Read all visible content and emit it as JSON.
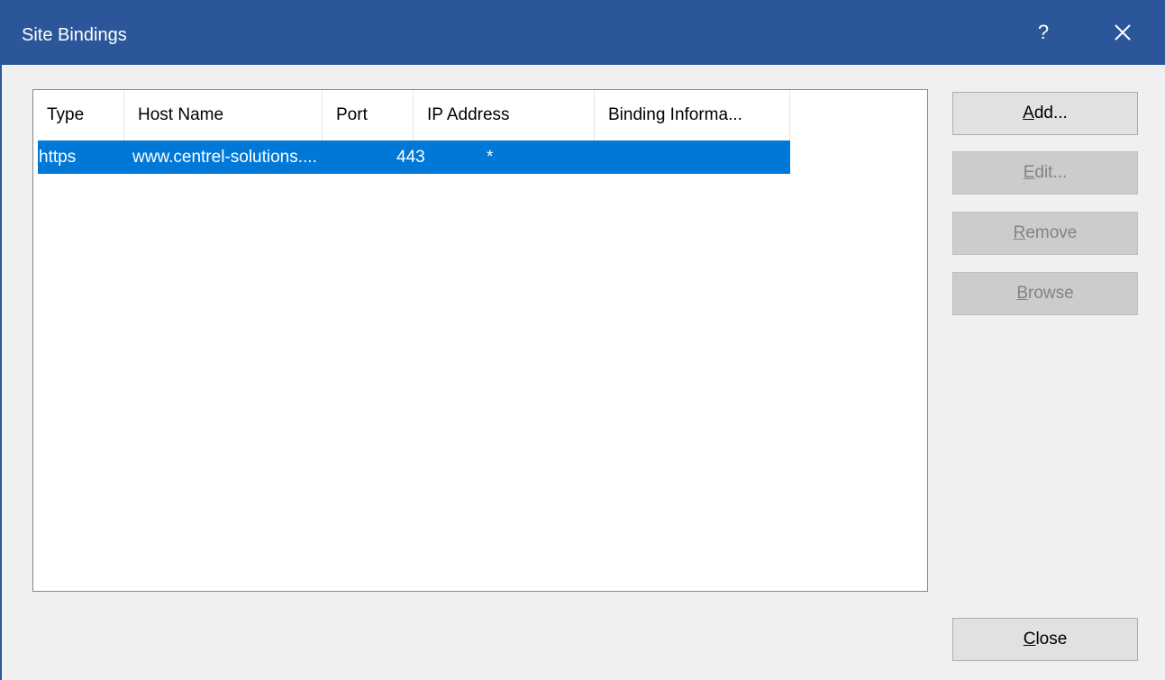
{
  "window": {
    "title": "Site Bindings",
    "help_glyph": "?"
  },
  "columns": [
    "Type",
    "Host Name",
    "Port",
    "IP Address",
    "Binding Informa..."
  ],
  "rows": [
    {
      "type": "https",
      "host": "www.centrel-solutions....",
      "port": "443",
      "ip": "*",
      "binding": "",
      "selected": true
    }
  ],
  "buttons": {
    "add": {
      "mnemonic": "A",
      "rest": "dd...",
      "enabled": true
    },
    "edit": {
      "mnemonic": "E",
      "rest": "dit...",
      "enabled": false
    },
    "remove": {
      "mnemonic": "R",
      "rest": "emove",
      "enabled": false
    },
    "browse": {
      "mnemonic": "B",
      "rest": "rowse",
      "enabled": false
    },
    "close": {
      "mnemonic": "C",
      "rest": "lose",
      "enabled": true
    }
  },
  "colors": {
    "titlebar": "#2b579a",
    "selection": "#0078d7"
  }
}
